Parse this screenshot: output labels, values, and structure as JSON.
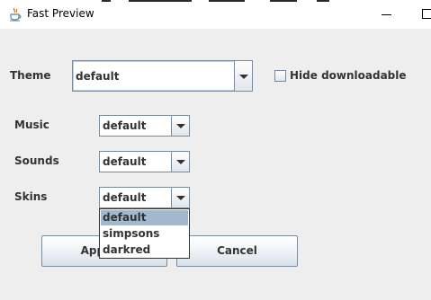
{
  "window": {
    "title": "Fast Preview"
  },
  "theme": {
    "label": "Theme",
    "value": "default"
  },
  "hide_downloadable": {
    "label": "Hide downloadable",
    "checked": false
  },
  "music": {
    "label": "Music",
    "value": "default"
  },
  "sounds": {
    "label": "Sounds",
    "value": "default"
  },
  "skins": {
    "label": "Skins",
    "value": "default",
    "options": [
      "default",
      "simpsons",
      "darkred"
    ],
    "highlighted": "default"
  },
  "buttons": {
    "apply_label": "Apply/D",
    "cancel_label": "Cancel"
  },
  "icons": {
    "app": "java-cup-icon",
    "minimize": "minimize-icon",
    "maximize": "maximize-icon",
    "dropdown_arrow": "chevron-down-icon"
  },
  "colors": {
    "selection": "#a3b8cc",
    "border": "#7a8a99",
    "text": "#333333",
    "background": "#eeeeee"
  }
}
